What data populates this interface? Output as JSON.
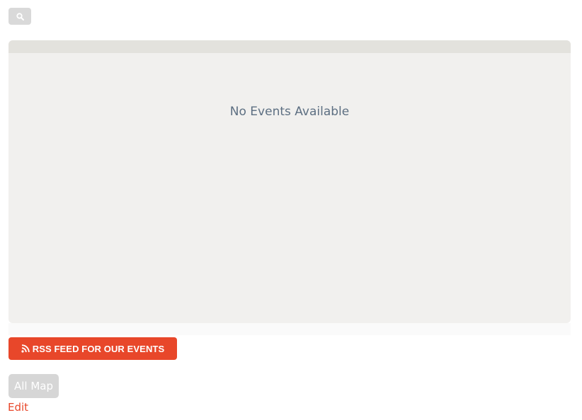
{
  "search": {
    "icon": "search-icon"
  },
  "events_panel": {
    "empty_message": "No Events Available"
  },
  "rss": {
    "label": "RSS FEED FOR OUR EVENTS",
    "icon": "rss-icon",
    "color": "#e8472a"
  },
  "map_button": {
    "label": "All Map"
  },
  "edit_link": {
    "label": "Edit",
    "color": "#e8472a"
  }
}
